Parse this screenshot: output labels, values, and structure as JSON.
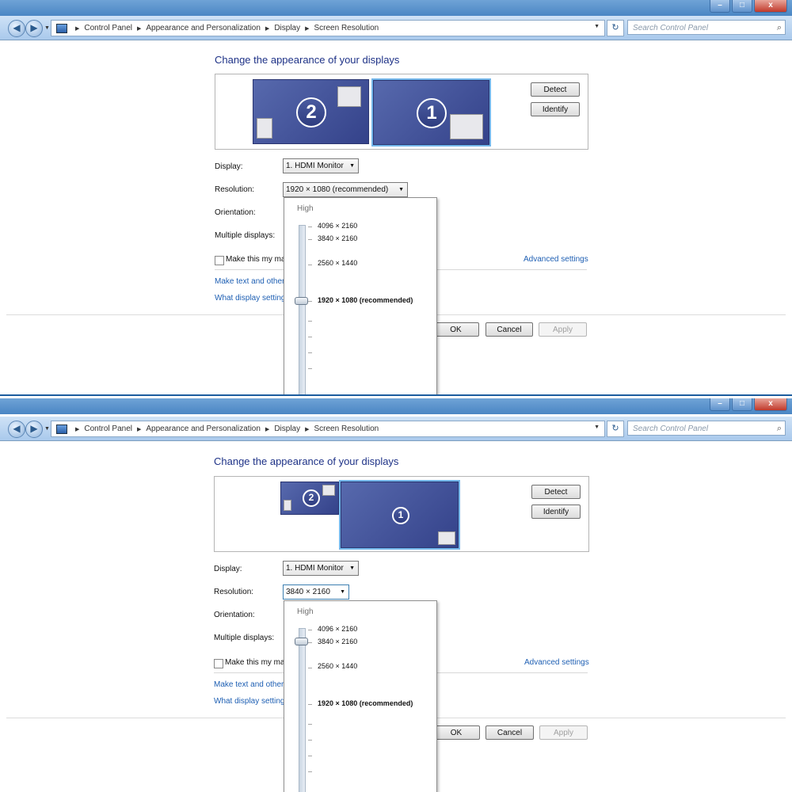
{
  "window": {
    "minimize_icon": "minimize-icon",
    "maximize_icon": "maximize-icon",
    "close_label": "x",
    "minimize_label": "–",
    "maximize_label": "□"
  },
  "address": {
    "breadcrumbs": [
      "Control Panel",
      "Appearance and Personalization",
      "Display",
      "Screen Resolution"
    ],
    "search_placeholder": "Search Control Panel"
  },
  "content": {
    "heading": "Change the appearance of your displays",
    "detect_label": "Detect",
    "identify_label": "Identify",
    "display_label": "Display:",
    "display_value": "1. HDMI Monitor",
    "resolution_label": "Resolution:",
    "orientation_label": "Orientation:",
    "multiple_displays_label": "Multiple displays:",
    "make_main_text": "Make this my ma",
    "advanced_settings": "Advanced settings",
    "make_text_link": "Make text and other",
    "what_display_link": "What display setting",
    "ok_label": "OK",
    "cancel_label": "Cancel",
    "apply_label": "Apply"
  },
  "dropdown": {
    "high_label": "High",
    "options": [
      "4096 × 2160",
      "3840 × 2160",
      "2560 × 1440",
      "1920 × 1080 (recommended)"
    ]
  },
  "panels": [
    {
      "resolution_value": "1920 × 1080 (recommended)",
      "monitor_1_number": "1",
      "monitor_2_number": "2",
      "selected_option": "1920 × 1080 (recommended)"
    },
    {
      "resolution_value": "3840 × 2160",
      "monitor_1_number": "1",
      "monitor_2_number": "2",
      "selected_option": "3840 × 2160"
    }
  ],
  "colors": {
    "heading": "#1e3287",
    "link": "#1e5fb3",
    "monitor": "#4a5ba0",
    "selection_outline": "#73b6ea"
  }
}
